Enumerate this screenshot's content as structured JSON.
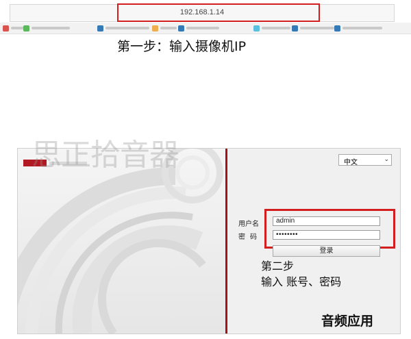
{
  "browser": {
    "url": "192.168.1.14",
    "bookmarks": [
      {
        "icon_color": "#d9534f"
      },
      {
        "icon_color": "#5cb85c"
      },
      {
        "icon_color": "#337ab7"
      },
      {
        "icon_color": "#f0ad4e"
      },
      {
        "icon_color": "#337ab7"
      },
      {
        "icon_color": "#5bc0de"
      },
      {
        "icon_color": "#337ab7"
      },
      {
        "icon_color": "#337ab7"
      }
    ]
  },
  "annotations": {
    "step1": "第一步：输入摄像机IP",
    "step2_line1": "第二步",
    "step2_line2": "输入 账号、密码",
    "highlight_color": "#d21e1e"
  },
  "watermarks": {
    "top": "思正拾音器",
    "bottom": "音频应用"
  },
  "login": {
    "language": "中文",
    "username_label": "用户名",
    "password_label": "密码",
    "username_value": "admin",
    "password_value": "••••••••",
    "login_button": "登录",
    "accent_color": "#a3131b"
  }
}
